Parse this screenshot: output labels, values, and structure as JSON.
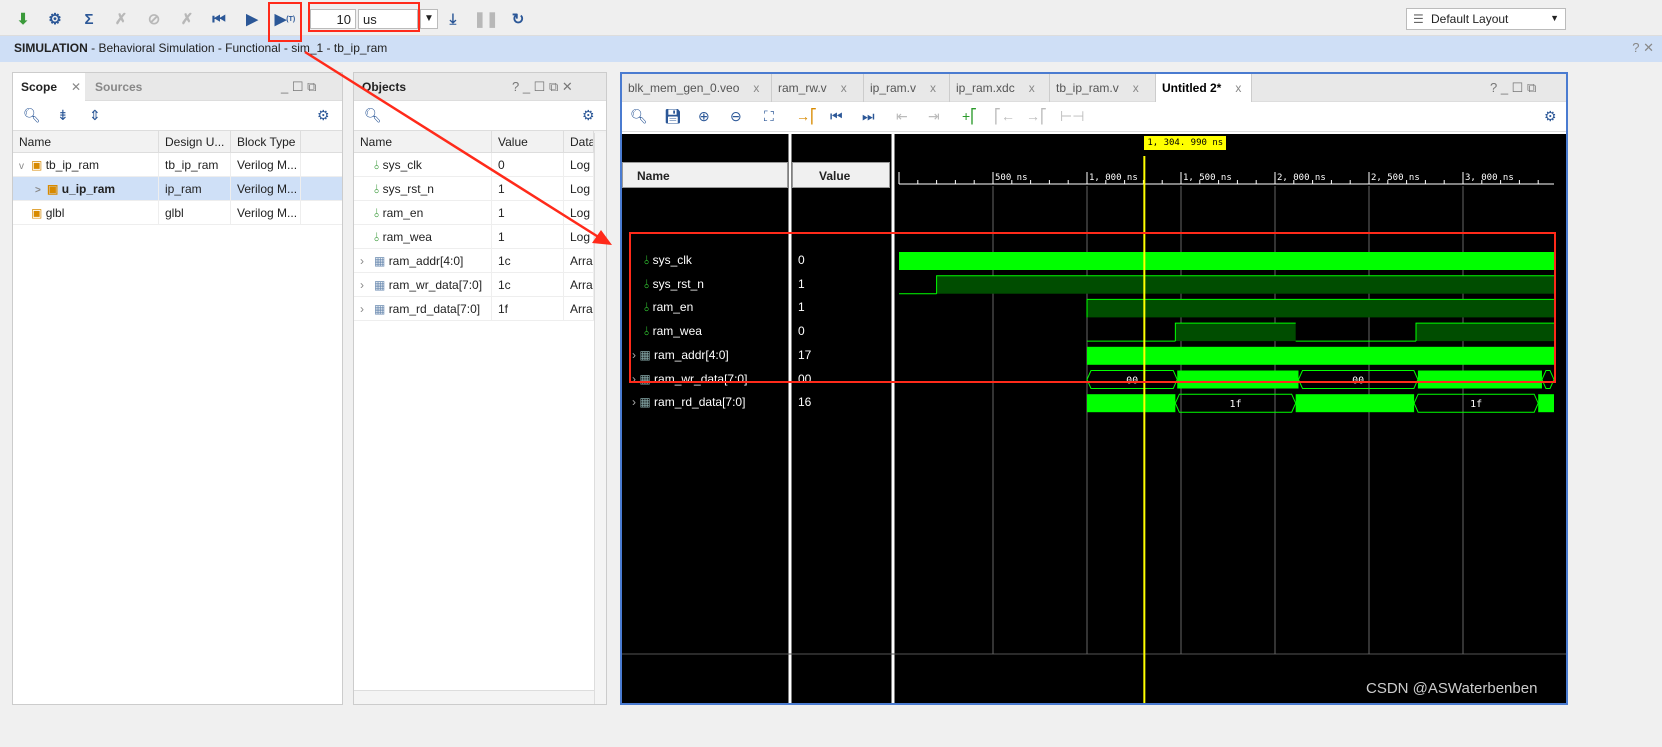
{
  "toolbar": {
    "icons": [
      "restart-01-icon",
      "settings-icon",
      "sigma-icon",
      "disabled-icon-1",
      "disabled-icon-2",
      "disabled-icon-3",
      "restart-icon",
      "run-all-icon",
      "run-for-time-icon"
    ],
    "run_time_value": "10",
    "run_time_unit": "us",
    "run_step_label": "(T)",
    "layout": "Default Layout"
  },
  "simbar": {
    "bold": "SIMULATION",
    "rest": " - Behavioral Simulation - Functional - sim_1 - tb_ip_ram"
  },
  "scope": {
    "tabs": [
      "Scope",
      "Sources"
    ],
    "columns": [
      "Name",
      "Design U...",
      "Block Type"
    ],
    "rows": [
      {
        "name": "tb_ip_ram",
        "unit": "tb_ip_ram",
        "type": "Verilog M...",
        "expand": "v"
      },
      {
        "name": "u_ip_ram",
        "unit": "ip_ram",
        "type": "Verilog M...",
        "expand": ">"
      },
      {
        "name": "glbl",
        "unit": "glbl",
        "type": "Verilog M...",
        "expand": ""
      }
    ]
  },
  "objects": {
    "title": "Objects",
    "columns": [
      "Name",
      "Value",
      "Data"
    ],
    "rows": [
      {
        "name": "sys_clk",
        "value": "0",
        "type": "Log"
      },
      {
        "name": "sys_rst_n",
        "value": "1",
        "type": "Log"
      },
      {
        "name": "ram_en",
        "value": "1",
        "type": "Log"
      },
      {
        "name": "ram_wea",
        "value": "1",
        "type": "Log"
      },
      {
        "name": "ram_addr[4:0]",
        "value": "1c",
        "type": "Arra"
      },
      {
        "name": "ram_wr_data[7:0]",
        "value": "1c",
        "type": "Arra"
      },
      {
        "name": "ram_rd_data[7:0]",
        "value": "1f",
        "type": "Arra"
      }
    ]
  },
  "editor": {
    "tabs": [
      "blk_mem_gen_0.veo",
      "ram_rw.v",
      "ip_ram.v",
      "ip_ram.xdc",
      "tb_ip_ram.v",
      "Untitled 2*"
    ],
    "name_header": "Name",
    "value_header": "Value",
    "cursor_label": "1, 304. 990 ns",
    "cursor_time_ns": 1304.99,
    "time_ticks": [
      "500 ns",
      "1, 000 ns",
      "1, 500 ns",
      "2, 000 ns",
      "2, 500 ns",
      "3, 000 ns"
    ],
    "signals": [
      {
        "name": "sys_clk",
        "value": "0",
        "kind": "clock",
        "segments": [
          [
            0,
            3500,
            "dense"
          ]
        ]
      },
      {
        "name": "sys_rst_n",
        "value": "1",
        "kind": "bit",
        "segments": [
          [
            0,
            200,
            "0"
          ],
          [
            200,
            3500,
            "1"
          ]
        ]
      },
      {
        "name": "ram_en",
        "value": "1",
        "kind": "bit",
        "segments": [
          [
            1000,
            3500,
            "1"
          ]
        ]
      },
      {
        "name": "ram_wea",
        "value": "0",
        "kind": "bit",
        "segments": [
          [
            1000,
            1470,
            "0"
          ],
          [
            1470,
            2110,
            "1"
          ],
          [
            2110,
            2750,
            "0"
          ],
          [
            2750,
            3500,
            "1"
          ]
        ]
      },
      {
        "name": "ram_addr[4:0]",
        "value": "17",
        "kind": "bus",
        "segments": [
          [
            1000,
            3500,
            "dense"
          ]
        ]
      },
      {
        "name": "ram_wr_data[7:0]",
        "value": "00",
        "kind": "bus",
        "segments": [
          [
            1000,
            1480,
            "00"
          ],
          [
            1480,
            2125,
            "dense"
          ],
          [
            2125,
            2760,
            "00"
          ],
          [
            2760,
            3420,
            "dense"
          ],
          [
            3420,
            3500,
            ""
          ]
        ]
      },
      {
        "name": "ram_rd_data[7:0]",
        "value": "16",
        "kind": "bus",
        "segments": [
          [
            1000,
            1470,
            "dense"
          ],
          [
            1470,
            2110,
            "1f"
          ],
          [
            2110,
            2740,
            "dense"
          ],
          [
            2740,
            3400,
            "1f"
          ],
          [
            3400,
            3500,
            "dense"
          ]
        ]
      }
    ]
  },
  "watermark": "CSDN @ASWaterbenben",
  "colors": {
    "wave": "#00ff00",
    "wave_dark": "#004d00",
    "cursor": "#ffff00",
    "annotation": "#ff2a1a"
  }
}
